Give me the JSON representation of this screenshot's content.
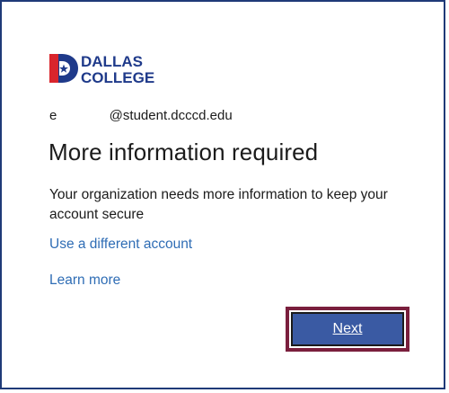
{
  "logo": {
    "line1": "DALLAS",
    "line2": "COLLEGE",
    "colors": {
      "blue": "#1f3a8a",
      "red": "#d9252c",
      "white": "#ffffff"
    }
  },
  "account": {
    "identity": "e              @student.dcccd.edu"
  },
  "page": {
    "title": "More information required",
    "description": "Your organization needs more information to keep your account secure"
  },
  "links": {
    "different_account": "Use a different account",
    "learn_more": "Learn more"
  },
  "buttons": {
    "next": "Next"
  },
  "colors": {
    "link": "#2f6db5",
    "button": "#3a5aa3",
    "highlight": "#7a1f3d",
    "frame": "#1f3a78"
  }
}
